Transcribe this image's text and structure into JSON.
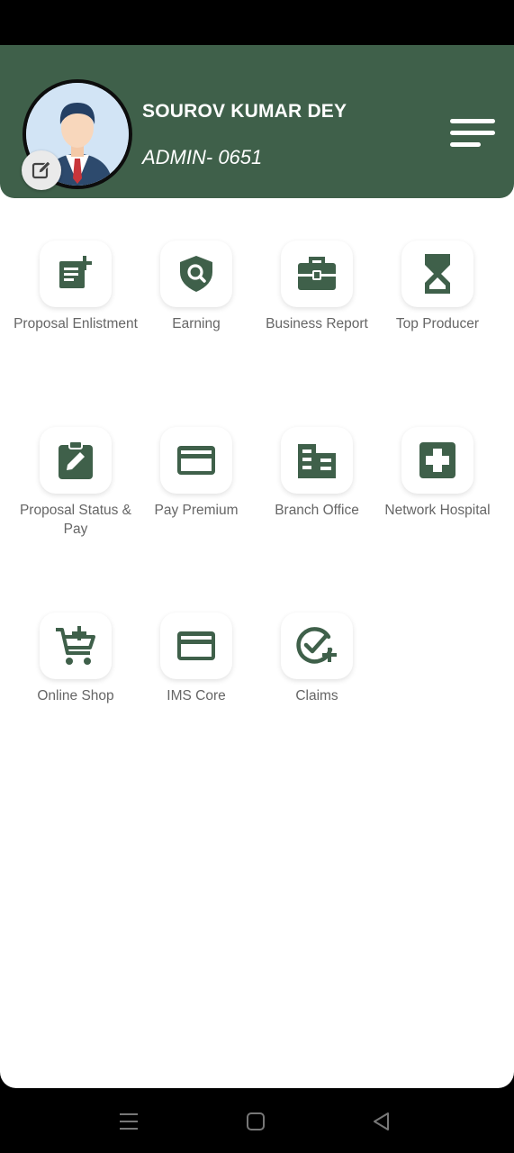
{
  "profile": {
    "name": "SOUROV KUMAR DEY",
    "id_label": "ADMIN- 0651"
  },
  "menu_items": [
    {
      "label": "Proposal Enlistment",
      "icon": "document-add-icon"
    },
    {
      "label": "Earning",
      "icon": "shield-search-icon"
    },
    {
      "label": "Business Report",
      "icon": "briefcase-icon"
    },
    {
      "label": "Top Producer",
      "icon": "hourglass-icon"
    },
    {
      "label": "Proposal Status & Pay",
      "icon": "clipboard-edit-icon"
    },
    {
      "label": "Pay Premium",
      "icon": "credit-card-icon"
    },
    {
      "label": "Branch Office",
      "icon": "building-icon"
    },
    {
      "label": "Network Hospital",
      "icon": "medical-cross-icon"
    },
    {
      "label": "Online Shop",
      "icon": "cart-add-icon"
    },
    {
      "label": "IMS Core",
      "icon": "credit-card-icon"
    },
    {
      "label": "Claims",
      "icon": "check-add-icon"
    }
  ],
  "colors": {
    "header": "#3f604a",
    "icon": "#3f604a",
    "label": "#666666"
  }
}
